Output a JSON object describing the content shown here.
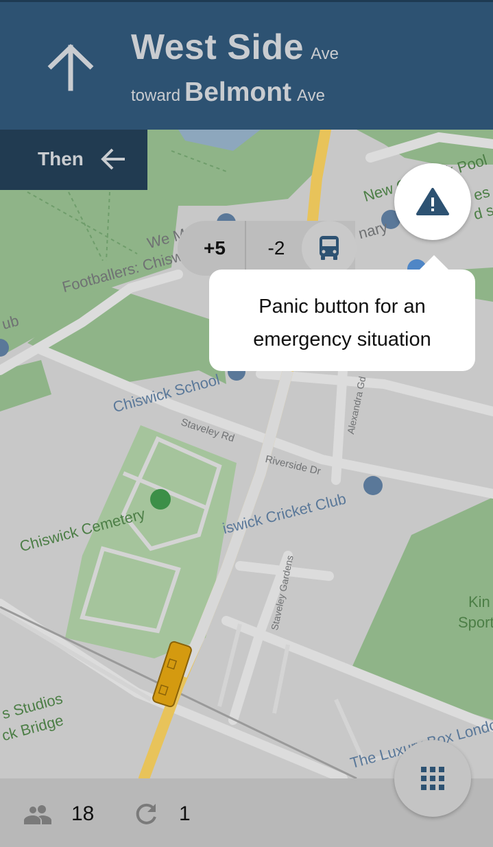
{
  "header": {
    "street_main": "West Side",
    "street_suffix": "Ave",
    "toward_label": "toward",
    "toward_main": "Belmont",
    "toward_suffix": "Ave",
    "direction_icon": "arrow-up-icon"
  },
  "then": {
    "label": "Then",
    "icon": "arrow-left-icon"
  },
  "map": {
    "labels": [
      {
        "text": "New Chiswick Pool"
      },
      {
        "text": "We M"
      },
      {
        "text": "Footballers: Chisw"
      },
      {
        "text": "nary"
      },
      {
        "text": "ub"
      },
      {
        "text": "Chiswick School"
      },
      {
        "text": "Staveley Rd"
      },
      {
        "text": "Riverside Dr"
      },
      {
        "text": "Alexandra Gd"
      },
      {
        "text": "iswick Cricket Club"
      },
      {
        "text": "Chiswick Cemetery"
      },
      {
        "text": "Staveley Gardens"
      },
      {
        "text": "Kin"
      },
      {
        "text": "Sport"
      },
      {
        "text": "s Studios"
      },
      {
        "text": "ck Bridge"
      },
      {
        "text": "The Luxury Box Londo"
      },
      {
        "text": "es"
      },
      {
        "text": "d sa"
      }
    ]
  },
  "counter": {
    "plus_label": "+5",
    "minus_label": "-2",
    "bus_icon": "bus-icon"
  },
  "panic": {
    "icon": "warning-icon",
    "tooltip": "Panic button for an emergency situation"
  },
  "bottom": {
    "passengers_icon": "people-icon",
    "passengers": "18",
    "refresh_icon": "refresh-icon",
    "refresh_count": "1",
    "menu_icon": "grid-icon"
  },
  "colors": {
    "header_bg": "#2d5272",
    "then_bg": "#213b51",
    "accent_icon": "#2d5272",
    "route": "#e8c35a"
  }
}
